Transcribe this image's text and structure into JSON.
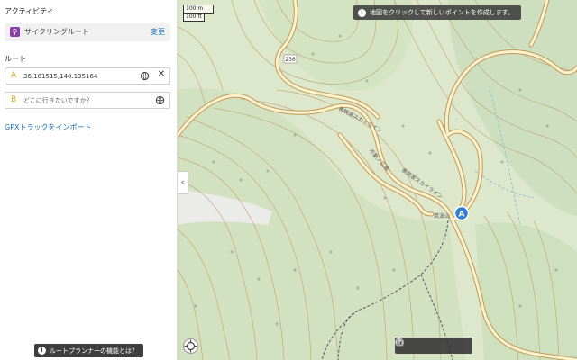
{
  "panel": {
    "activity_title": "アクティビティ",
    "activity": {
      "icon": "bicycle-icon",
      "label": "サイクリングルート",
      "change_label": "変更"
    },
    "route_title": "ルート",
    "route": {
      "start": {
        "letter": "A",
        "value": "36.181515,140.135164"
      },
      "destination": {
        "letter": "B",
        "placeholder": "どこに行きたいですか？"
      }
    },
    "gpx_import_label": "GPXトラックをインポート",
    "planner_help_label": "ルートプランナーの機能とは？"
  },
  "map": {
    "scale": {
      "metric": "100 m",
      "imperial": "100 ft"
    },
    "hint": "地図をクリックして新しいポイントを作成します。",
    "road_number": "236",
    "place_labels": [
      "表筑波スカイライン",
      "不動ノ広場",
      "表筑波スカイライン",
      "筑波山"
    ],
    "marker": {
      "letter": "A",
      "color": "#2e7dd7"
    },
    "toolbar": {
      "buttons": [
        "undo-icon",
        "redo-icon",
        "reverse-route-icon",
        "clear-route-icon"
      ]
    }
  },
  "colors": {
    "accent": "#1b6fb5",
    "waypoint_letter": "#d8a818",
    "road_outline": "#c39a55",
    "road_fill": "#fbf2cf",
    "forest": "#cfe0bd",
    "contour": "#b79a6c"
  }
}
